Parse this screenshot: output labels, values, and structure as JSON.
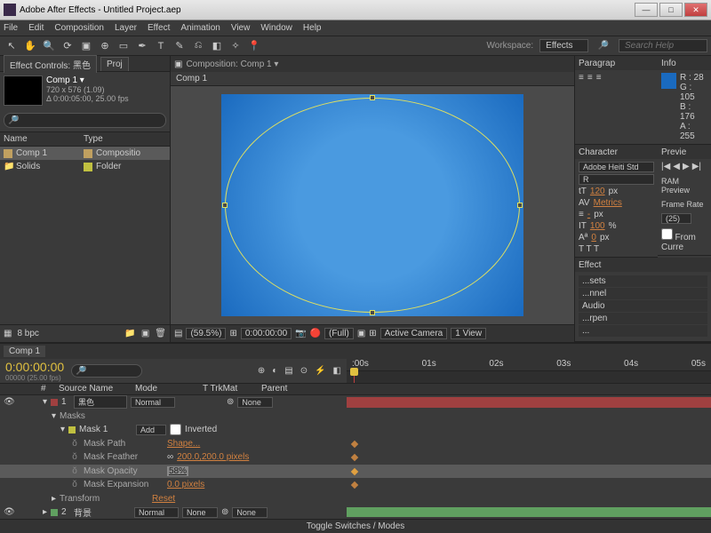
{
  "window": {
    "title": "Adobe After Effects - Untitled Project.aep"
  },
  "menu": [
    "File",
    "Edit",
    "Composition",
    "Layer",
    "Effect",
    "Animation",
    "View",
    "Window",
    "Help"
  ],
  "workspace": {
    "label": "Workspace:",
    "value": "Effects"
  },
  "search_placeholder": "Search Help",
  "project": {
    "ec_tab": "Effect Controls: 黑色",
    "proj_tab": "Proj",
    "comp_name": "Comp 1 ▾",
    "dims": "720 x 576 (1.09)",
    "duration": "Δ 0:00:05:00, 25.00 fps",
    "cols": {
      "name": "Name",
      "type": "Type"
    },
    "rows": [
      {
        "name": "Comp 1",
        "type": "Compositio"
      },
      {
        "name": "Solids",
        "type": "Folder"
      }
    ],
    "bpc": "8 bpc"
  },
  "composition": {
    "tabprefix": "Composition: Comp 1 ▾",
    "crumb": "Comp 1",
    "zoom": "(59.5%)",
    "time": "0:00:00:00",
    "res": "(Full)",
    "camera": "Active Camera",
    "views": "1 View"
  },
  "panels": {
    "paragraph": "Paragrap",
    "info": {
      "title": "Info",
      "r": "R : 28",
      "g": "G : 105",
      "b": "B : 176",
      "a": "A : 255"
    },
    "character": {
      "title": "Character",
      "font": "Adobe Heiti Std",
      "style": "R",
      "size": "120",
      "size_unit": "px",
      "kerning": "Metrics",
      "tracking": "-",
      "tracking_unit": "px",
      "vscale": "100",
      "vscale_unit": "%",
      "baseline": "0",
      "baseline_unit": "px",
      "btns": "T   T   T"
    },
    "preview": {
      "title": "Previe",
      "ram": "RAM Preview",
      "framerate_lbl": "Frame Rate",
      "framerate": "(25)",
      "fromcur": "From Curre"
    },
    "effects": {
      "title": "Effect",
      "items": [
        "...sets",
        "...nnel",
        "Audio",
        "...rpen",
        "..."
      ]
    }
  },
  "timeline": {
    "tab": "Comp 1",
    "timecode": "0:00:00:00",
    "timecode_sub": "00000 (25.00 fps)",
    "ruler": [
      ":00s",
      "01s",
      "02s",
      "03s",
      "04s",
      "05s"
    ],
    "cols": {
      "source": "Source Name",
      "mode": "Mode",
      "trkmat": "T  TrkMat",
      "parent": "Parent"
    },
    "layer1": {
      "num": "1",
      "name": "黑色",
      "mode": "Normal",
      "parent": "None"
    },
    "masks_label": "Masks",
    "mask1": {
      "name": "Mask 1",
      "mode": "Add",
      "inverted": "Inverted"
    },
    "props": {
      "path": {
        "name": "Mask Path",
        "val": "Shape..."
      },
      "feather": {
        "name": "Mask Feather",
        "val": "200.0,200.0 pixels"
      },
      "opacity": {
        "name": "Mask Opacity",
        "val": "58%"
      },
      "expansion": {
        "name": "Mask Expansion",
        "val": "0.0 pixels"
      }
    },
    "transform": {
      "name": "Transform",
      "val": "Reset"
    },
    "layer2": {
      "num": "2",
      "name": "背景",
      "mode": "Normal",
      "trkmat": "None",
      "parent": "None"
    },
    "toggle": "Toggle Switches / Modes"
  }
}
